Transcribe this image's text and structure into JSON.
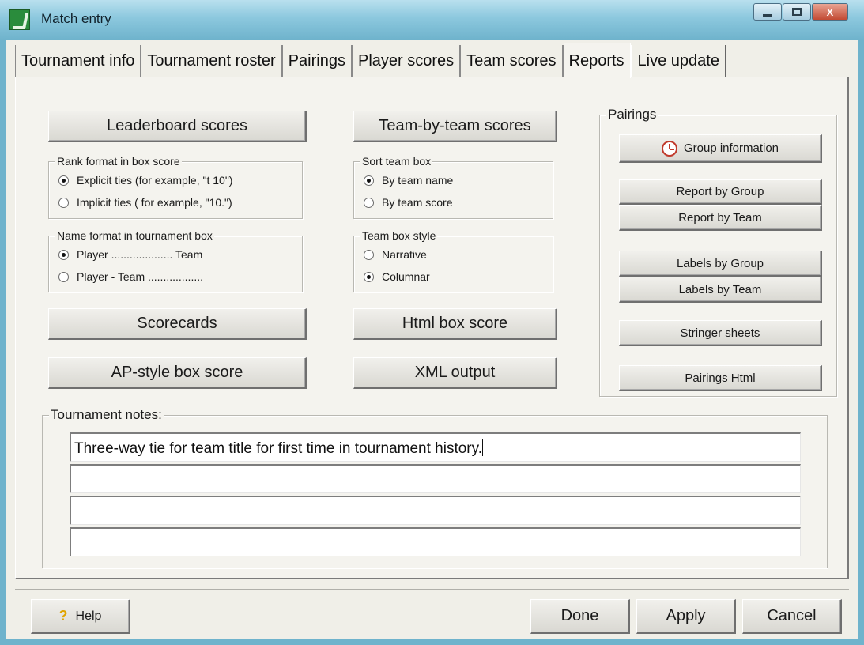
{
  "window": {
    "title": "Match entry",
    "controls": [
      "minimize-icon",
      "maximize-icon",
      "close-icon"
    ],
    "close_glyph": "X"
  },
  "tabs": [
    {
      "label": "Tournament info",
      "active": false
    },
    {
      "label": "Tournament roster",
      "active": false
    },
    {
      "label": "Pairings",
      "active": false
    },
    {
      "label": "Player scores",
      "active": false
    },
    {
      "label": "Team scores",
      "active": false
    },
    {
      "label": "Reports",
      "active": true
    },
    {
      "label": "Live update",
      "active": false
    }
  ],
  "left_column": {
    "leaderboard_button": "Leaderboard scores",
    "rank_format": {
      "title": "Rank format in box score",
      "options": [
        {
          "label": "Explicit ties (for example, \"t 10\")",
          "selected": true
        },
        {
          "label": "Implicit ties ( for example, \"10.\")",
          "selected": false
        }
      ]
    },
    "name_format": {
      "title": "Name format in tournament box",
      "options": [
        {
          "label": "Player .................... Team",
          "selected": true
        },
        {
          "label": "Player - Team ..................",
          "selected": false
        }
      ]
    },
    "scorecards_button": "Scorecards",
    "ap_style_button": "AP-style box score"
  },
  "middle_column": {
    "team_by_team_button": "Team-by-team scores",
    "sort_team_box": {
      "title": "Sort team box",
      "options": [
        {
          "label": "By team name",
          "selected": true
        },
        {
          "label": "By team score",
          "selected": false
        }
      ]
    },
    "team_box_style": {
      "title": "Team box style",
      "options": [
        {
          "label": "Narrative",
          "selected": false
        },
        {
          "label": "Columnar",
          "selected": true
        }
      ]
    },
    "html_box_button": "Html box score",
    "xml_button": "XML output"
  },
  "pairings": {
    "title": "Pairings",
    "group_info_button": "Group information",
    "group_info_icon": "clock-icon",
    "report_by_group": "Report by Group",
    "report_by_team": "Report by Team",
    "labels_by_group": "Labels by Group",
    "labels_by_team": "Labels by Team",
    "stringer_sheets": "Stringer sheets",
    "pairings_html": "Pairings Html"
  },
  "notes": {
    "title": "Tournament notes:",
    "lines": [
      "Three-way tie for team title for first time in tournament history.",
      "",
      "",
      ""
    ]
  },
  "footer": {
    "help": "Help",
    "help_icon": "question-mark-icon",
    "done": "Done",
    "apply": "Apply",
    "cancel": "Cancel"
  },
  "colors": {
    "window_frame": "#6fb3cc",
    "close_button": "#c24a33",
    "panel_background": "#f4f3ee"
  }
}
